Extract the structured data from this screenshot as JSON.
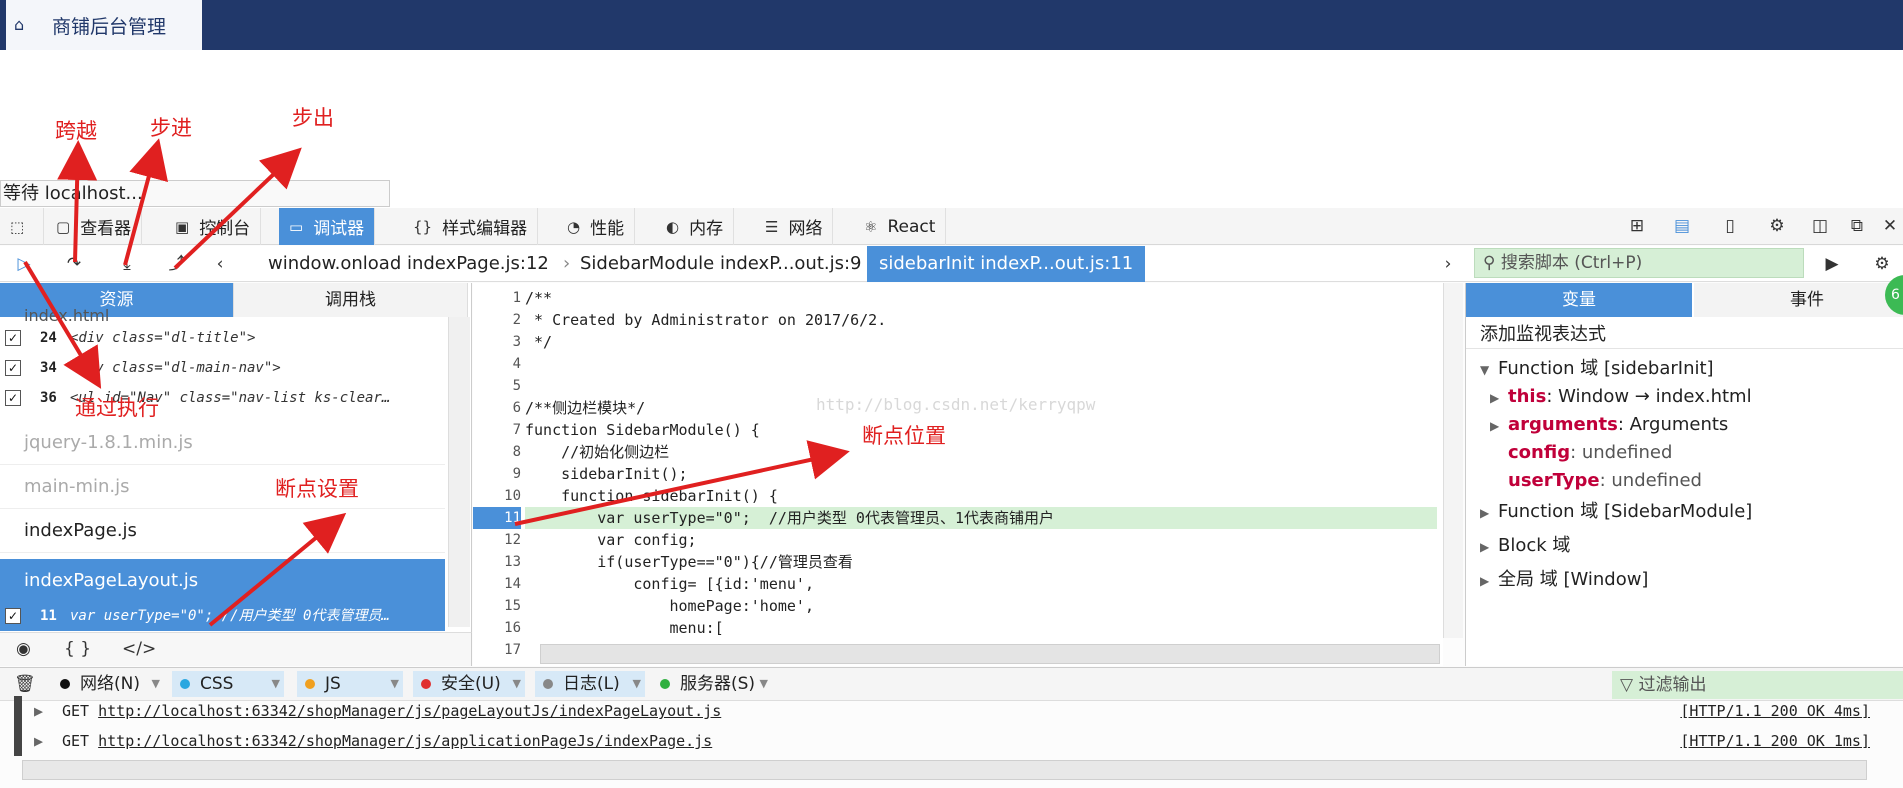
{
  "app": {
    "title": "商铺后台管理"
  },
  "status_text": "等待 localhost...",
  "toolbar": {
    "tabs": [
      "查看器",
      "控制台",
      "调试器",
      "样式编辑器",
      "性能",
      "内存",
      "网络",
      "React"
    ]
  },
  "debugger": {
    "breadcrumbs": [
      "window.onload indexPage.js:12",
      "SidebarModule indexP...out.js:9",
      "sidebarInit indexP...out.js:11"
    ],
    "search_placeholder": "搜索脚本 (Ctrl+P)"
  },
  "left": {
    "tabs": [
      "资源",
      "调用栈"
    ],
    "partial_file": "index.html",
    "breakpoints": [
      {
        "line": "24",
        "code": "<div class=\"dl-title\">"
      },
      {
        "line": "34",
        "code": "<div class=\"dl-main-nav\">"
      },
      {
        "line": "36",
        "code": "<ul id=\"Nav\"  class=\"nav-list ks-clear…"
      }
    ],
    "sources": [
      {
        "name": "jquery-1.8.1.min.js"
      },
      {
        "name": "main-min.js"
      },
      {
        "name": "indexPage.js"
      },
      {
        "name": "indexPageLayout.js"
      }
    ],
    "selected_bp": {
      "line": "11",
      "code": "var userType=\"0\";  //用户类型 0代表管理员…"
    },
    "footer_icons": [
      "eye-icon",
      "braces-icon",
      "tag-slash-icon"
    ]
  },
  "editor": {
    "lines": [
      {
        "n": "1",
        "t": "/**"
      },
      {
        "n": "2",
        "t": " * Created by Administrator on 2017/6/2."
      },
      {
        "n": "3",
        "t": " */"
      },
      {
        "n": "4",
        "t": ""
      },
      {
        "n": "5",
        "t": ""
      },
      {
        "n": "6",
        "t": "/**侧边栏模块*/"
      },
      {
        "n": "7",
        "t": "function SidebarModule() {"
      },
      {
        "n": "8",
        "t": "    //初始化侧边栏"
      },
      {
        "n": "9",
        "t": "    sidebarInit();"
      },
      {
        "n": "10",
        "t": "    function sidebarInit() {"
      },
      {
        "n": "11",
        "t": "        var userType=\"0\";  //用户类型 0代表管理员、1代表商铺用户"
      },
      {
        "n": "12",
        "t": "        var config;"
      },
      {
        "n": "13",
        "t": "        if(userType==\"0\"){//管理员查看"
      },
      {
        "n": "14",
        "t": "            config= [{id:'menu',"
      },
      {
        "n": "15",
        "t": "                homePage:'home',"
      },
      {
        "n": "16",
        "t": "                menu:["
      },
      {
        "n": "17",
        "t": ""
      }
    ],
    "watermark": "http://blog.csdn.net/kerryqpw"
  },
  "right": {
    "tabs": [
      "变量",
      "事件"
    ],
    "add_watch": "添加监视表达式",
    "scopes": {
      "fn_scope": "Function 域 [sidebarInit]",
      "this_name": "this",
      "this_value": ": Window → index.html",
      "args_name": "arguments",
      "args_value": ": Arguments",
      "config_name": "config",
      "config_value": ": undefined",
      "usertype_name": "userType",
      "usertype_value": ": undefined",
      "module_scope": "Function 域 [SidebarModule]",
      "block_scope": "Block 域",
      "global_scope": "全局 域 [Window]"
    },
    "badge": "6"
  },
  "console": {
    "filters": [
      {
        "label": "网络(N)",
        "color": "#111111"
      },
      {
        "label": "CSS",
        "color": "#2aa7e0"
      },
      {
        "label": "JS",
        "color": "#f0a020"
      },
      {
        "label": "安全(U)",
        "color": "#e03030"
      },
      {
        "label": "日志(L)",
        "color": "#888888"
      },
      {
        "label": "服务器(S)",
        "color": "#30b040"
      }
    ],
    "filter_output": "过滤输出",
    "logs": [
      {
        "method": "GET",
        "url": "http://localhost:63342/shopManager/js/pageLayoutJs/indexPageLayout.js",
        "status": "[HTTP/1.1 200 OK 4ms]"
      },
      {
        "method": "GET",
        "url": "http://localhost:63342/shopManager/js/applicationPageJs/indexPage.js",
        "status": "[HTTP/1.1 200 OK 1ms]"
      }
    ]
  },
  "annotations": {
    "step_over": "跨越",
    "step_in": "步进",
    "step_out": "步出",
    "resume": "通过执行",
    "set_breakpoint": "断点设置",
    "breakpoint_pos": "断点位置"
  },
  "colors": {
    "header": "#21386a",
    "accent": "#4a90d9",
    "highlight": "#d6f0d6",
    "annotation": "#e02020"
  }
}
